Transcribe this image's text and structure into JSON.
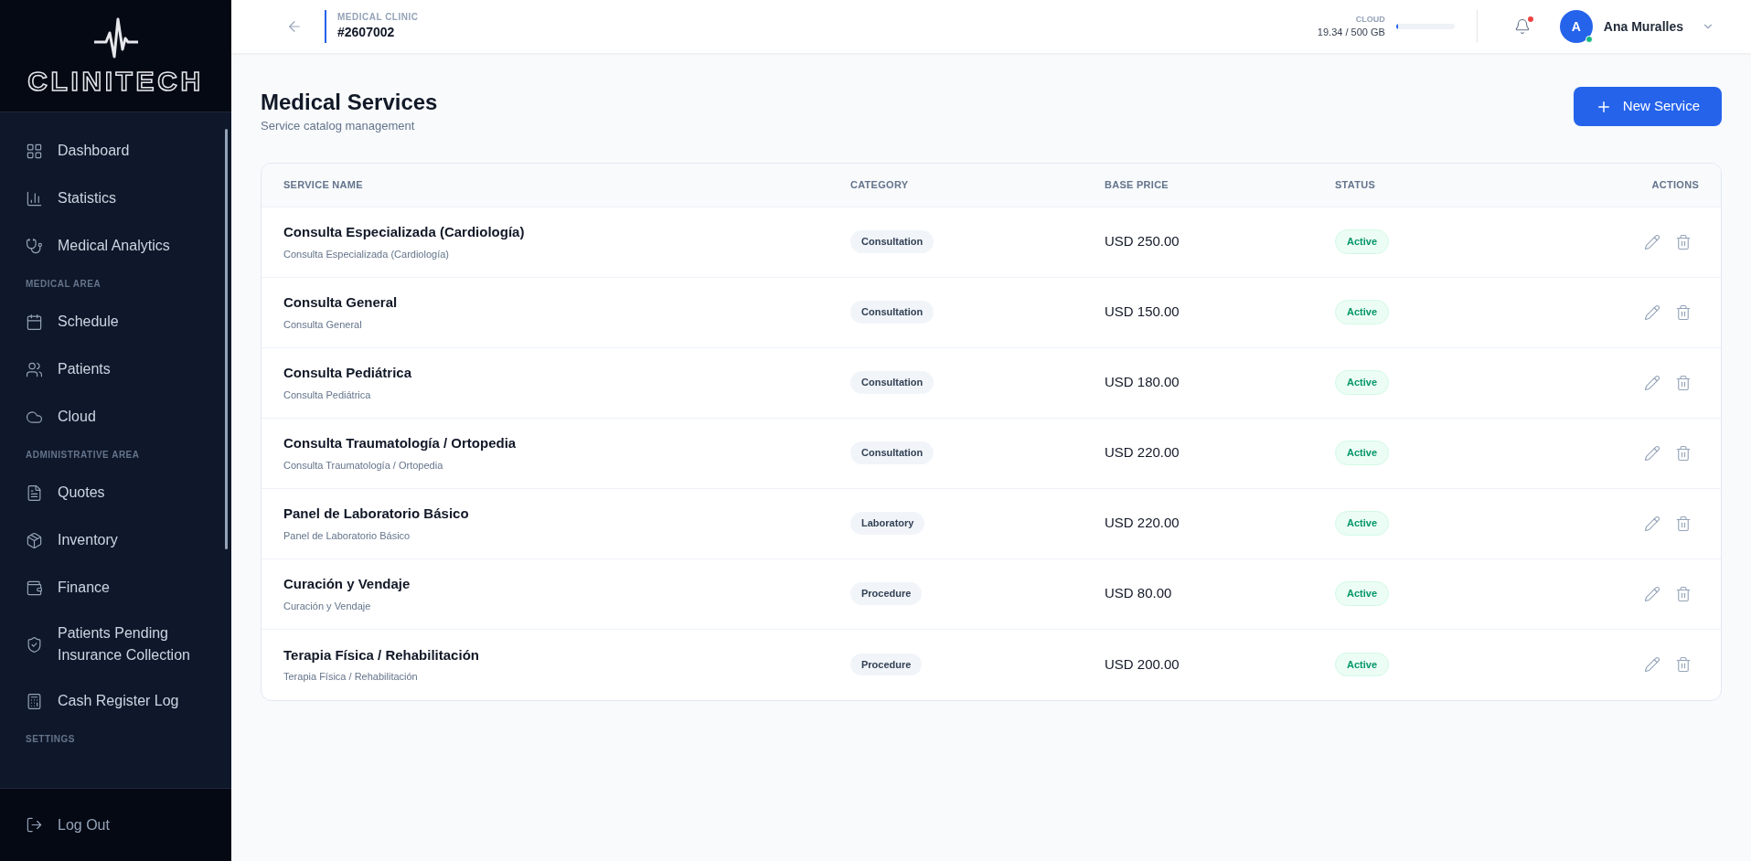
{
  "sidebar": {
    "logo": "CLINITECH",
    "sections": [
      {
        "items": [
          {
            "label": "Dashboard",
            "selected": false
          },
          {
            "label": "Statistics",
            "selected": false
          },
          {
            "label": "Medical Analytics",
            "selected": false
          }
        ]
      },
      {
        "heading": "MEDICAL AREA",
        "items": [
          {
            "label": "Schedule",
            "selected": false
          },
          {
            "label": "Patients",
            "selected": false
          },
          {
            "label": "Cloud",
            "selected": false
          }
        ]
      },
      {
        "heading": "ADMINISTRATIVE AREA",
        "items": [
          {
            "label": "Quotes",
            "selected": false
          },
          {
            "label": "Inventory",
            "selected": false
          },
          {
            "label": "Finance",
            "selected": false
          },
          {
            "label": "Patients Pending Insurance Collection",
            "selected": false
          },
          {
            "label": "Cash Register Log",
            "selected": false
          }
        ]
      },
      {
        "heading": "SETTINGS"
      }
    ],
    "logout": "Log Out"
  },
  "header": {
    "clinic_label": "MEDICAL CLINIC",
    "clinic_id": "#2607002",
    "storage": {
      "label": "CLOUD",
      "reading": "19.34 / 500 GB",
      "level": 0.04
    },
    "notifications_unread": true,
    "user": {
      "initial": "A",
      "name": "Ana Muralles",
      "online": true
    }
  },
  "page": {
    "title": "Medical Services",
    "subtitle": "Service catalog management",
    "new_button": "New Service"
  },
  "table": {
    "columns": [
      "SERVICE NAME",
      "CATEGORY",
      "BASE PRICE",
      "STATUS",
      "ACTIONS"
    ],
    "rows": [
      {
        "name": "Consulta Especializada (Cardiología)",
        "description": "Consulta Especializada (Cardiología)",
        "category": "Consultation",
        "price": "USD 250.00",
        "status": "Active",
        "active": true
      },
      {
        "name": "Consulta General",
        "description": "Consulta General",
        "category": "Consultation",
        "price": "USD 150.00",
        "status": "Active",
        "active": true
      },
      {
        "name": "Consulta Pediátrica",
        "description": "Consulta Pediátrica",
        "category": "Consultation",
        "price": "USD 180.00",
        "status": "Active",
        "active": true
      },
      {
        "name": "Consulta Traumatología / Ortopedia",
        "description": "Consulta Traumatología / Ortopedia",
        "category": "Consultation",
        "price": "USD 220.00",
        "status": "Active",
        "active": true
      },
      {
        "name": "Panel de Laboratorio Básico",
        "description": "Panel de Laboratorio Básico",
        "category": "Laboratory",
        "price": "USD 220.00",
        "status": "Active",
        "active": true
      },
      {
        "name": "Curación y Vendaje",
        "description": "Curación y Vendaje",
        "category": "Procedure",
        "price": "USD 80.00",
        "status": "Active",
        "active": true
      },
      {
        "name": "Terapia Física / Rehabilitación",
        "description": "Terapia Física / Rehabilitación",
        "category": "Procedure",
        "price": "USD 200.00",
        "status": "Active",
        "active": true
      }
    ]
  }
}
